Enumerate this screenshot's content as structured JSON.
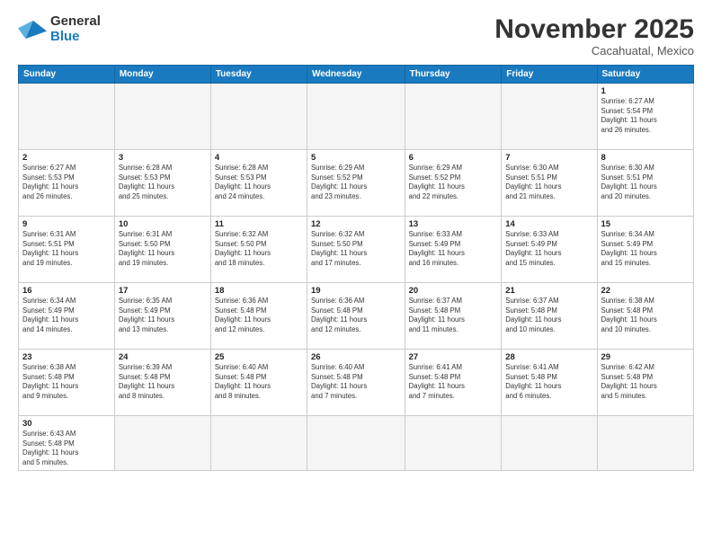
{
  "header": {
    "logo_line1": "General",
    "logo_line2": "Blue",
    "month_title": "November 2025",
    "location": "Cacahuatal, Mexico"
  },
  "weekdays": [
    "Sunday",
    "Monday",
    "Tuesday",
    "Wednesday",
    "Thursday",
    "Friday",
    "Saturday"
  ],
  "weeks": [
    [
      {
        "day": "",
        "info": ""
      },
      {
        "day": "",
        "info": ""
      },
      {
        "day": "",
        "info": ""
      },
      {
        "day": "",
        "info": ""
      },
      {
        "day": "",
        "info": ""
      },
      {
        "day": "",
        "info": ""
      },
      {
        "day": "1",
        "info": "Sunrise: 6:27 AM\nSunset: 5:54 PM\nDaylight: 11 hours\nand 26 minutes."
      }
    ],
    [
      {
        "day": "2",
        "info": "Sunrise: 6:27 AM\nSunset: 5:53 PM\nDaylight: 11 hours\nand 26 minutes."
      },
      {
        "day": "3",
        "info": "Sunrise: 6:28 AM\nSunset: 5:53 PM\nDaylight: 11 hours\nand 25 minutes."
      },
      {
        "day": "4",
        "info": "Sunrise: 6:28 AM\nSunset: 5:53 PM\nDaylight: 11 hours\nand 24 minutes."
      },
      {
        "day": "5",
        "info": "Sunrise: 6:29 AM\nSunset: 5:52 PM\nDaylight: 11 hours\nand 23 minutes."
      },
      {
        "day": "6",
        "info": "Sunrise: 6:29 AM\nSunset: 5:52 PM\nDaylight: 11 hours\nand 22 minutes."
      },
      {
        "day": "7",
        "info": "Sunrise: 6:30 AM\nSunset: 5:51 PM\nDaylight: 11 hours\nand 21 minutes."
      },
      {
        "day": "8",
        "info": "Sunrise: 6:30 AM\nSunset: 5:51 PM\nDaylight: 11 hours\nand 20 minutes."
      }
    ],
    [
      {
        "day": "9",
        "info": "Sunrise: 6:31 AM\nSunset: 5:51 PM\nDaylight: 11 hours\nand 19 minutes."
      },
      {
        "day": "10",
        "info": "Sunrise: 6:31 AM\nSunset: 5:50 PM\nDaylight: 11 hours\nand 19 minutes."
      },
      {
        "day": "11",
        "info": "Sunrise: 6:32 AM\nSunset: 5:50 PM\nDaylight: 11 hours\nand 18 minutes."
      },
      {
        "day": "12",
        "info": "Sunrise: 6:32 AM\nSunset: 5:50 PM\nDaylight: 11 hours\nand 17 minutes."
      },
      {
        "day": "13",
        "info": "Sunrise: 6:33 AM\nSunset: 5:49 PM\nDaylight: 11 hours\nand 16 minutes."
      },
      {
        "day": "14",
        "info": "Sunrise: 6:33 AM\nSunset: 5:49 PM\nDaylight: 11 hours\nand 15 minutes."
      },
      {
        "day": "15",
        "info": "Sunrise: 6:34 AM\nSunset: 5:49 PM\nDaylight: 11 hours\nand 15 minutes."
      }
    ],
    [
      {
        "day": "16",
        "info": "Sunrise: 6:34 AM\nSunset: 5:49 PM\nDaylight: 11 hours\nand 14 minutes."
      },
      {
        "day": "17",
        "info": "Sunrise: 6:35 AM\nSunset: 5:49 PM\nDaylight: 11 hours\nand 13 minutes."
      },
      {
        "day": "18",
        "info": "Sunrise: 6:36 AM\nSunset: 5:48 PM\nDaylight: 11 hours\nand 12 minutes."
      },
      {
        "day": "19",
        "info": "Sunrise: 6:36 AM\nSunset: 5:48 PM\nDaylight: 11 hours\nand 12 minutes."
      },
      {
        "day": "20",
        "info": "Sunrise: 6:37 AM\nSunset: 5:48 PM\nDaylight: 11 hours\nand 11 minutes."
      },
      {
        "day": "21",
        "info": "Sunrise: 6:37 AM\nSunset: 5:48 PM\nDaylight: 11 hours\nand 10 minutes."
      },
      {
        "day": "22",
        "info": "Sunrise: 6:38 AM\nSunset: 5:48 PM\nDaylight: 11 hours\nand 10 minutes."
      }
    ],
    [
      {
        "day": "23",
        "info": "Sunrise: 6:38 AM\nSunset: 5:48 PM\nDaylight: 11 hours\nand 9 minutes."
      },
      {
        "day": "24",
        "info": "Sunrise: 6:39 AM\nSunset: 5:48 PM\nDaylight: 11 hours\nand 8 minutes."
      },
      {
        "day": "25",
        "info": "Sunrise: 6:40 AM\nSunset: 5:48 PM\nDaylight: 11 hours\nand 8 minutes."
      },
      {
        "day": "26",
        "info": "Sunrise: 6:40 AM\nSunset: 5:48 PM\nDaylight: 11 hours\nand 7 minutes."
      },
      {
        "day": "27",
        "info": "Sunrise: 6:41 AM\nSunset: 5:48 PM\nDaylight: 11 hours\nand 7 minutes."
      },
      {
        "day": "28",
        "info": "Sunrise: 6:41 AM\nSunset: 5:48 PM\nDaylight: 11 hours\nand 6 minutes."
      },
      {
        "day": "29",
        "info": "Sunrise: 6:42 AM\nSunset: 5:48 PM\nDaylight: 11 hours\nand 5 minutes."
      }
    ],
    [
      {
        "day": "30",
        "info": "Sunrise: 6:43 AM\nSunset: 5:48 PM\nDaylight: 11 hours\nand 5 minutes."
      },
      {
        "day": "",
        "info": ""
      },
      {
        "day": "",
        "info": ""
      },
      {
        "day": "",
        "info": ""
      },
      {
        "day": "",
        "info": ""
      },
      {
        "day": "",
        "info": ""
      },
      {
        "day": "",
        "info": ""
      }
    ]
  ]
}
